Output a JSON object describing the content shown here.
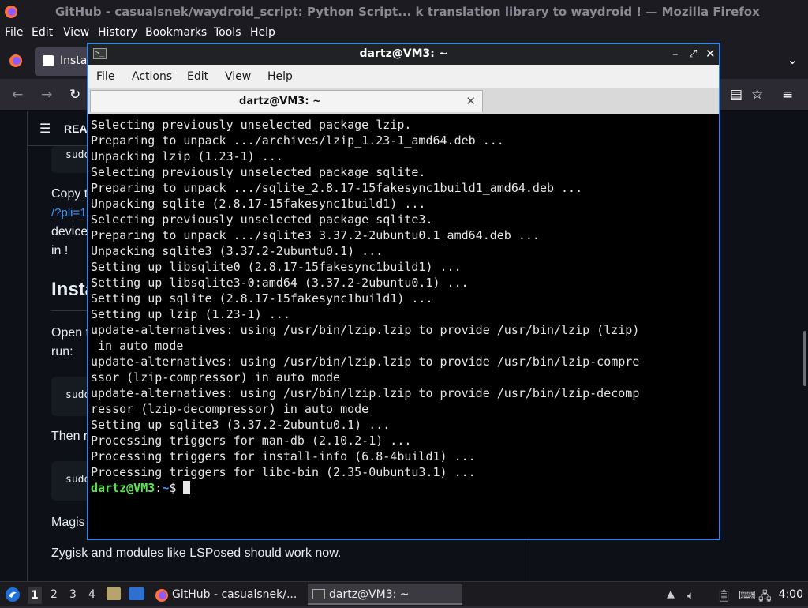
{
  "firefox": {
    "window_title": "GitHub - casualsnek/waydroid_script: Python Script... k translation library to waydroid ! — Mozilla Firefox",
    "menu": [
      "File",
      "Edit",
      "View",
      "History",
      "Bookmarks",
      "Tools",
      "Help"
    ],
    "tab_label_partial": "Insta",
    "readme_label": "REA",
    "article": {
      "code1": "sudo",
      "copy_line": "Copy t",
      "link_partial": "/?pli=1",
      "device_line": "device",
      "in_line": "in !",
      "heading_partial": "Insta",
      "open_line": "Open t",
      "run_line": "run:",
      "code2": "sudo",
      "then_line": "Then r",
      "code3": "sudo",
      "magisk_line": "Magis",
      "zygisk_line": "Zygisk and modules like LSPosed should work now."
    }
  },
  "terminal": {
    "title": "dartz@VM3: ~",
    "menu": [
      "File",
      "Actions",
      "Edit",
      "View",
      "Help"
    ],
    "tab_label": "dartz@VM3: ~",
    "lines": [
      "Selecting previously unselected package lzip.",
      "Preparing to unpack .../archives/lzip_1.23-1_amd64.deb ...",
      "Unpacking lzip (1.23-1) ...",
      "Selecting previously unselected package sqlite.",
      "Preparing to unpack .../sqlite_2.8.17-15fakesync1build1_amd64.deb ...",
      "Unpacking sqlite (2.8.17-15fakesync1build1) ...",
      "Selecting previously unselected package sqlite3.",
      "Preparing to unpack .../sqlite3_3.37.2-2ubuntu0.1_amd64.deb ...",
      "Unpacking sqlite3 (3.37.2-2ubuntu0.1) ...",
      "Setting up libsqlite0 (2.8.17-15fakesync1build1) ...",
      "Setting up libsqlite3-0:amd64 (3.37.2-2ubuntu0.1) ...",
      "Setting up sqlite (2.8.17-15fakesync1build1) ...",
      "Setting up lzip (1.23-1) ...",
      "update-alternatives: using /usr/bin/lzip.lzip to provide /usr/bin/lzip (lzip)",
      " in auto mode",
      "update-alternatives: using /usr/bin/lzip.lzip to provide /usr/bin/lzip-compre",
      "ssor (lzip-compressor) in auto mode",
      "update-alternatives: using /usr/bin/lzip.lzip to provide /usr/bin/lzip-decomp",
      "ressor (lzip-decompressor) in auto mode",
      "Setting up sqlite3 (3.37.2-2ubuntu0.1) ...",
      "Processing triggers for man-db (2.10.2-1) ...",
      "Processing triggers for install-info (6.8-4build1) ...",
      "Processing triggers for libc-bin (2.35-0ubuntu3.1) ..."
    ],
    "prompt_user": "dartz@VM3",
    "prompt_sep": ":",
    "prompt_path": "~",
    "prompt_symbol": "$"
  },
  "taskbar": {
    "workspaces": [
      "1",
      "2",
      "3",
      "4"
    ],
    "tasks": [
      {
        "label": "GitHub - casualsnek/..."
      },
      {
        "label": "dartz@VM3: ~"
      }
    ],
    "clock": "4:00"
  }
}
